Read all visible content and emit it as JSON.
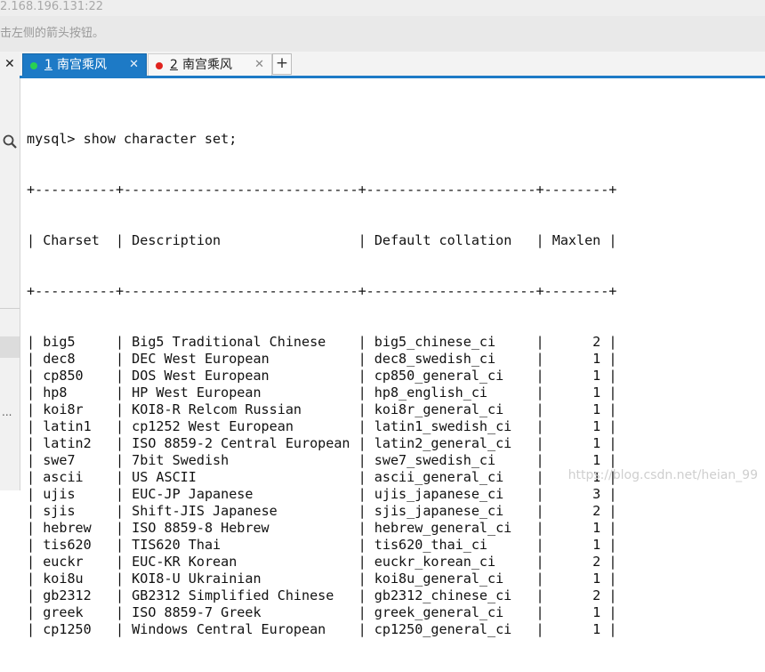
{
  "window": {
    "address": "2.168.196.131:22",
    "hint": "击左侧的箭头按钮。"
  },
  "tabs": [
    {
      "number": "1",
      "name": "南宫乘风",
      "status_color": "#29d152",
      "active": true
    },
    {
      "number": "2",
      "name": "南宫乘风",
      "status_color": "#e0231e",
      "active": false
    }
  ],
  "icons": {
    "close": "✕",
    "add_tab": "+",
    "more": "..."
  },
  "terminal": {
    "prompt": "mysql> ",
    "command": "show character set;",
    "separator": "+----------+-----------------------------+---------------------+--------+",
    "columns": [
      "Charset",
      "Description",
      "Default collation",
      "Maxlen"
    ],
    "rows": [
      [
        "big5",
        "Big5 Traditional Chinese",
        "big5_chinese_ci",
        "2"
      ],
      [
        "dec8",
        "DEC West European",
        "dec8_swedish_ci",
        "1"
      ],
      [
        "cp850",
        "DOS West European",
        "cp850_general_ci",
        "1"
      ],
      [
        "hp8",
        "HP West European",
        "hp8_english_ci",
        "1"
      ],
      [
        "koi8r",
        "KOI8-R Relcom Russian",
        "koi8r_general_ci",
        "1"
      ],
      [
        "latin1",
        "cp1252 West European",
        "latin1_swedish_ci",
        "1"
      ],
      [
        "latin2",
        "ISO 8859-2 Central European",
        "latin2_general_ci",
        "1"
      ],
      [
        "swe7",
        "7bit Swedish",
        "swe7_swedish_ci",
        "1"
      ],
      [
        "ascii",
        "US ASCII",
        "ascii_general_ci",
        "1"
      ],
      [
        "ujis",
        "EUC-JP Japanese",
        "ujis_japanese_ci",
        "3"
      ],
      [
        "sjis",
        "Shift-JIS Japanese",
        "sjis_japanese_ci",
        "2"
      ],
      [
        "hebrew",
        "ISO 8859-8 Hebrew",
        "hebrew_general_ci",
        "1"
      ],
      [
        "tis620",
        "TIS620 Thai",
        "tis620_thai_ci",
        "1"
      ],
      [
        "euckr",
        "EUC-KR Korean",
        "euckr_korean_ci",
        "2"
      ],
      [
        "koi8u",
        "KOI8-U Ukrainian",
        "koi8u_general_ci",
        "1"
      ],
      [
        "gb2312",
        "GB2312 Simplified Chinese",
        "gb2312_chinese_ci",
        "2"
      ],
      [
        "greek",
        "ISO 8859-7 Greek",
        "greek_general_ci",
        "1"
      ],
      [
        "cp1250",
        "Windows Central European",
        "cp1250_general_ci",
        "1"
      ]
    ]
  },
  "watermark": "https://blog.csdn.net/heian_99"
}
